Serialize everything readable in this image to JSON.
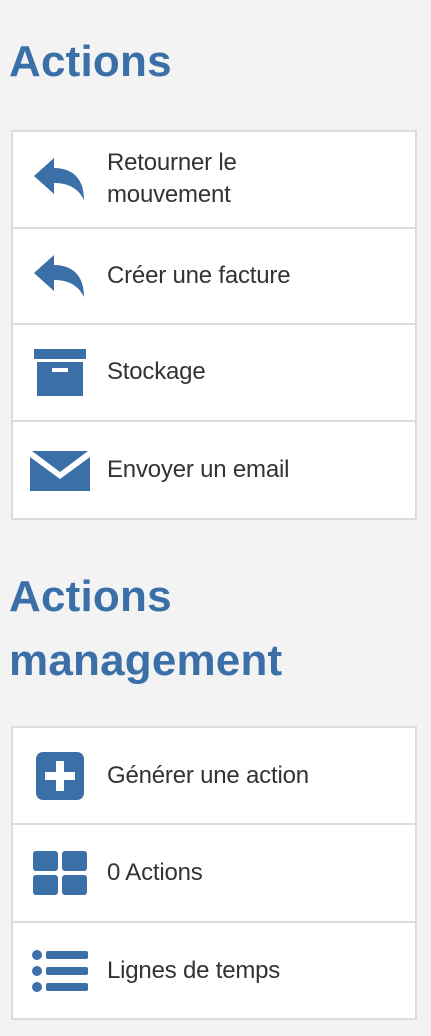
{
  "actions": {
    "title": "Actions",
    "items": [
      {
        "label": "Retourner le mouvement",
        "icon": "reply-arrow-icon"
      },
      {
        "label": "Créer une facture",
        "icon": "reply-arrow-icon"
      },
      {
        "label": "Stockage",
        "icon": "archive-box-icon"
      },
      {
        "label": "Envoyer un email",
        "icon": "envelope-icon"
      }
    ]
  },
  "management": {
    "title": "Actions management",
    "items": [
      {
        "label": "Générer une action",
        "icon": "plus-square-icon"
      },
      {
        "label": "0 Actions",
        "icon": "grid-tiles-icon"
      },
      {
        "label": "Lignes de temps",
        "icon": "list-bullets-icon"
      }
    ]
  },
  "colors": {
    "accent": "#3a6fa8",
    "text": "#333333",
    "border": "#dcdcdc",
    "background": "#f3f3f3",
    "panel": "#ffffff"
  }
}
